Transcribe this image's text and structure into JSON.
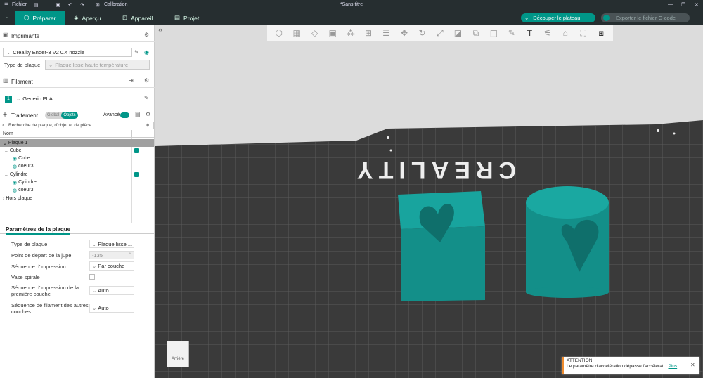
{
  "titlebar": {
    "file_menu": "Fichier",
    "calibration": "Calibration",
    "document_title": "*Sans titre"
  },
  "tabs": [
    {
      "label": "Préparer"
    },
    {
      "label": "Aperçu"
    },
    {
      "label": "Appareil"
    },
    {
      "label": "Projet"
    }
  ],
  "actions": {
    "slice_label": "Découper le plateau",
    "export_label": "Exporter le fichier G-code"
  },
  "printer": {
    "section_label": "Imprimante",
    "name": "Creality Ender-3 V2 0.4 nozzle",
    "plate_type_label": "Type de plaque",
    "plate_type_value": "Plaque lisse haute température"
  },
  "filament": {
    "section_label": "Filament",
    "slot": "1",
    "name": "Generic PLA"
  },
  "process": {
    "section_label": "Traitement",
    "toggle_global": "Global",
    "toggle_objects": "Objets",
    "advanced_label": "Avancé",
    "search_placeholder": "Recherche de plaque, d'objet et de pièce.",
    "column_name": "Nom"
  },
  "tree": {
    "plate": "Plaque 1",
    "obj1": "Cube",
    "obj1_part": "Cube",
    "obj1_mod": "coeur3",
    "obj2": "Cylindre",
    "obj2_part": "Cylindre",
    "obj2_mod": "coeur3",
    "outside": "Hors plaque"
  },
  "plate_params": {
    "tab": "Paramètres de la plaque",
    "rows": [
      {
        "label": "Type de plaque",
        "value": "Plaque lisse ..."
      },
      {
        "label": "Point de départ de la jupe",
        "value": "-135"
      },
      {
        "label": "Séquence d'impression",
        "value": "Par couche"
      },
      {
        "label": "Vase spirale",
        "value": ""
      },
      {
        "label": "Séquence d'impression de la première couche",
        "value": "Auto"
      },
      {
        "label": "Séquence de filament des autres couches",
        "value": "Auto"
      }
    ]
  },
  "viewport": {
    "bed_logo": "CREALITY",
    "view_cube_label": "Arrière"
  },
  "notification": {
    "title": "ATTENTION",
    "message": "Le paramètre d'accélération dépasse l'accélérati..",
    "link": "Plus"
  },
  "colors": {
    "accent": "#009688",
    "dark_bar": "#262e30",
    "bed": "#3a3a3a",
    "model": "#128f89",
    "warning": "#f08c2e"
  }
}
